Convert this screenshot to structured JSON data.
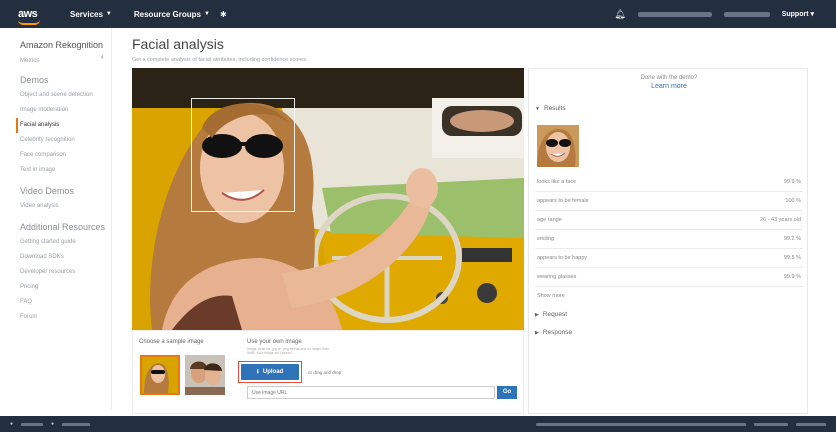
{
  "nav": {
    "logo": "aws",
    "services": "Services",
    "resource_groups": "Resource Groups",
    "support": "Support"
  },
  "sidebar": {
    "title": "Amazon Rekognition",
    "metrics": "Metrics",
    "sections": [
      {
        "heading": "Demos",
        "items": [
          "Object and scene detection",
          "Image moderation",
          "Facial analysis",
          "Celebrity recognition",
          "Face comparison",
          "Text in image"
        ]
      },
      {
        "heading": "Video Demos",
        "items": [
          "Video analysis"
        ]
      },
      {
        "heading": "Additional Resources",
        "items": [
          "Getting started guide",
          "Download SDKs",
          "Developer resources",
          "Pricing",
          "FAQ",
          "Forum"
        ]
      }
    ],
    "active_item": "Facial analysis"
  },
  "main": {
    "title": "Facial analysis",
    "subtitle": "Get a complete analysis of facial attributes, including confidence scores"
  },
  "sample": {
    "label": "Choose a sample image"
  },
  "own_image": {
    "label": "Use your own image",
    "help": "Image must be .jpg or .png format and no larger than 5MB. Your image isn't stored.",
    "upload_label": "Upload",
    "drag_text": "or drag and drop",
    "url_placeholder": "Use image URL",
    "go_label": "Go"
  },
  "results": {
    "done_text": "Done with the demo?",
    "learn_more": "Learn more",
    "results_heading": "Results",
    "rows": [
      {
        "label": "looks like a face",
        "value": "99.9 %"
      },
      {
        "label": "appears to be female",
        "value": "100 %"
      },
      {
        "label": "age range",
        "value": "26 - 43 years old"
      },
      {
        "label": "smiling",
        "value": "99.2 %"
      },
      {
        "label": "appears to be happy",
        "value": "99.5 %"
      },
      {
        "label": "wearing glasses",
        "value": "99.9 %"
      }
    ],
    "show_more": "Show more",
    "request_heading": "Request",
    "response_heading": "Response"
  },
  "colors": {
    "nav_bg": "#232f3e",
    "accent": "#e47911",
    "primary_button": "#2e73b8",
    "highlight_border": "#e74c3c",
    "link": "#2e73b8"
  }
}
